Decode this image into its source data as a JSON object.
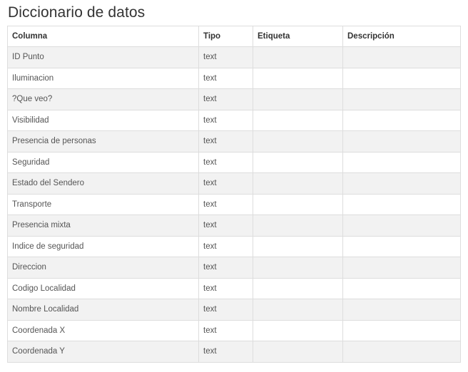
{
  "page": {
    "title": "Diccionario de datos"
  },
  "table": {
    "headers": {
      "columna": "Columna",
      "tipo": "Tipo",
      "etiqueta": "Etiqueta",
      "descripcion": "Descripción"
    },
    "rows": [
      {
        "columna": "ID Punto",
        "tipo": "text",
        "etiqueta": "",
        "descripcion": ""
      },
      {
        "columna": "Iluminacion",
        "tipo": "text",
        "etiqueta": "",
        "descripcion": ""
      },
      {
        "columna": "?Que veo?",
        "tipo": "text",
        "etiqueta": "",
        "descripcion": ""
      },
      {
        "columna": "Visibilidad",
        "tipo": "text",
        "etiqueta": "",
        "descripcion": ""
      },
      {
        "columna": "Presencia de personas",
        "tipo": "text",
        "etiqueta": "",
        "descripcion": ""
      },
      {
        "columna": "Seguridad",
        "tipo": "text",
        "etiqueta": "",
        "descripcion": ""
      },
      {
        "columna": "Estado del Sendero",
        "tipo": "text",
        "etiqueta": "",
        "descripcion": ""
      },
      {
        "columna": "Transporte",
        "tipo": "text",
        "etiqueta": "",
        "descripcion": ""
      },
      {
        "columna": "Presencia mixta",
        "tipo": "text",
        "etiqueta": "",
        "descripcion": ""
      },
      {
        "columna": "Indice de seguridad",
        "tipo": "text",
        "etiqueta": "",
        "descripcion": ""
      },
      {
        "columna": "Direccion",
        "tipo": "text",
        "etiqueta": "",
        "descripcion": ""
      },
      {
        "columna": "Codigo Localidad",
        "tipo": "text",
        "etiqueta": "",
        "descripcion": ""
      },
      {
        "columna": "Nombre Localidad",
        "tipo": "text",
        "etiqueta": "",
        "descripcion": ""
      },
      {
        "columna": "Coordenada X",
        "tipo": "text",
        "etiqueta": "",
        "descripcion": ""
      },
      {
        "columna": "Coordenada Y",
        "tipo": "text",
        "etiqueta": "",
        "descripcion": ""
      }
    ]
  },
  "colors": {
    "stripe": "#f2f2f2",
    "border": "#dddddd",
    "text": "#333333"
  }
}
